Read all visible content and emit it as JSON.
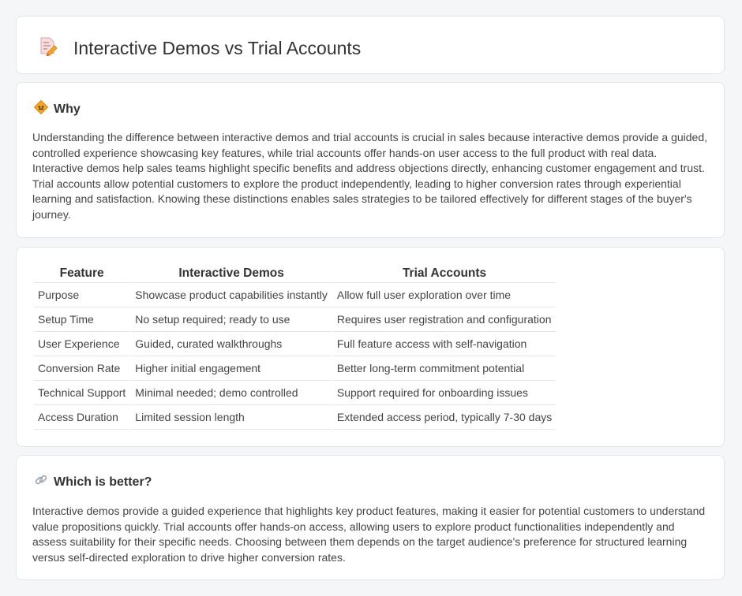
{
  "header": {
    "title": "Interactive Demos vs Trial Accounts",
    "icon": "document-pencil-icon"
  },
  "why": {
    "heading": "Why",
    "icon": "diamond-sign-icon",
    "text": "Understanding the difference between interactive demos and trial accounts is crucial in sales because interactive demos provide a guided, controlled experience showcasing key features, while trial accounts offer hands-on user access to the full product with real data. Interactive demos help sales teams highlight specific benefits and address objections directly, enhancing customer engagement and trust. Trial accounts allow potential customers to explore the product independently, leading to higher conversion rates through experiential learning and satisfaction. Knowing these distinctions enables sales strategies to be tailored effectively for different stages of the buyer's journey."
  },
  "table": {
    "headers": [
      "Feature",
      "Interactive Demos",
      "Trial Accounts"
    ],
    "rows": [
      [
        "Purpose",
        "Showcase product capabilities instantly",
        "Allow full user exploration over time"
      ],
      [
        "Setup Time",
        "No setup required; ready to use",
        "Requires user registration and configuration"
      ],
      [
        "User Experience",
        "Guided, curated walkthroughs",
        "Full feature access with self-navigation"
      ],
      [
        "Conversion Rate",
        "Higher initial engagement",
        "Better long-term commitment potential"
      ],
      [
        "Technical Support",
        "Minimal needed; demo controlled",
        "Support required for onboarding issues"
      ],
      [
        "Access Duration",
        "Limited session length",
        "Extended access period, typically 7-30 days"
      ]
    ]
  },
  "better": {
    "heading": "Which is better?",
    "icon": "link-icon",
    "text": "Interactive demos provide a guided experience that highlights key product features, making it easier for potential customers to understand value propositions quickly. Trial accounts offer hands-on access, allowing users to explore product functionalities independently and assess suitability for their specific needs. Choosing between them depends on the target audience's preference for structured learning versus self-directed exploration to drive higher conversion rates."
  },
  "colors": {
    "background": "#f4f6f8",
    "card_border": "#e2e6ea",
    "icon_orange": "#f5a623",
    "icon_red": "#e8604c"
  }
}
